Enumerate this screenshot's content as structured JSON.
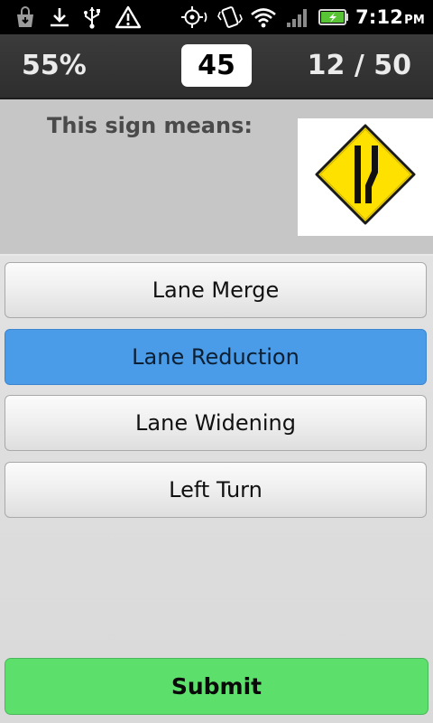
{
  "status_bar": {
    "time": "7:12",
    "ampm": "PM",
    "icons": [
      "shopping-bag-icon",
      "download-icon",
      "usb-icon",
      "warning-icon",
      "gps-icon",
      "vibrate-icon",
      "wifi-icon",
      "signal-icon",
      "battery-charging-icon"
    ]
  },
  "header": {
    "score": "55%",
    "timer": "45",
    "progress": "12 / 50"
  },
  "question": {
    "text": "This sign means:",
    "sign_icon": "lane-reduction-sign-icon"
  },
  "answers": [
    {
      "label": "Lane Merge",
      "selected": false
    },
    {
      "label": "Lane Reduction",
      "selected": true
    },
    {
      "label": "Lane Widening",
      "selected": false
    },
    {
      "label": "Left Turn",
      "selected": false
    }
  ],
  "submit": {
    "label": "Submit"
  },
  "colors": {
    "selected_answer": "#4a9be8",
    "submit_button": "#5de06b",
    "header_background": "#333333",
    "sign_yellow": "#ffe100"
  }
}
